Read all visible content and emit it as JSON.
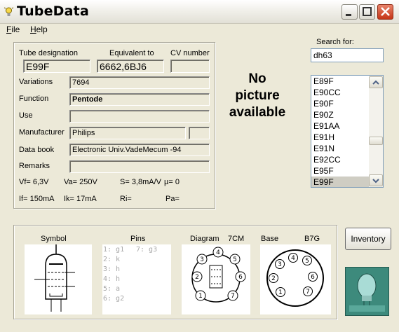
{
  "window": {
    "title": "TubeData"
  },
  "menu": [
    {
      "label": "File",
      "key": "F",
      "rest": "ile"
    },
    {
      "label": "Help",
      "key": "H",
      "rest": "elp"
    }
  ],
  "details": {
    "designation_label": "Tube designation",
    "designation": "E99F",
    "equivalent_label": "Equivalent to",
    "equivalent": "6662,6BJ6",
    "cv_label": "CV number",
    "cv": "",
    "variations_label": "Variations",
    "variations": "7694",
    "function_label": "Function",
    "function": "Pentode",
    "use_label": "Use",
    "use": "",
    "manufacturer_label": "Manufacturer",
    "manufacturer": "Philips",
    "manufacturer_extra": "",
    "databook_label": "Data book",
    "databook": "Electronic Univ.VadeMecum -94",
    "remarks_label": "Remarks",
    "remarks": "",
    "specs": {
      "vf": "Vf= 6,3V",
      "va": "Va=  250V",
      "s": "S= 3,8mA/V",
      "mu": "µ=    0",
      "if": "If= 150mA",
      "ik": "Ik=   17mA",
      "ri": "Ri=",
      "pa": "Pa="
    }
  },
  "picture_placeholder": [
    "No",
    "picture",
    "available"
  ],
  "search": {
    "label": "Search for:",
    "value": "dh63"
  },
  "tube_list": [
    "E89F",
    "E90CC",
    "E90F",
    "E90Z",
    "E91AA",
    "E91H",
    "E91N",
    "E92CC",
    "E95F",
    "E99F"
  ],
  "selected_tube": "E99F",
  "bottom": {
    "symbol_label": "Symbol",
    "pins_label": "Pins",
    "pins_col1": [
      "1: g1",
      "2: k",
      "3: h",
      "4: h",
      "5: a",
      "6: g2"
    ],
    "pins_col2": [
      "7: g3"
    ],
    "diagram_label": "Diagram",
    "diagram_code": "7CM",
    "base_label": "Base",
    "base_code": "B7G",
    "diagram_pins": [
      "1",
      "2",
      "3",
      "4",
      "5",
      "6",
      "7"
    ],
    "base_pins": [
      "1",
      "2",
      "3",
      "4",
      "5",
      "6",
      "7"
    ]
  },
  "inventory_button": "Inventory",
  "icons": [
    "lightbulb-icon",
    "minimize-icon",
    "maximize-icon",
    "close-icon",
    "scroll-up-icon",
    "scroll-down-icon",
    "tube-logo-icon"
  ],
  "colors": {
    "window_bg": "#ece9d8",
    "close_btn": "#c53517",
    "selection": "#cfcdc3",
    "input_border": "#7f9db9",
    "logo_bg": "#3d8a7c"
  }
}
